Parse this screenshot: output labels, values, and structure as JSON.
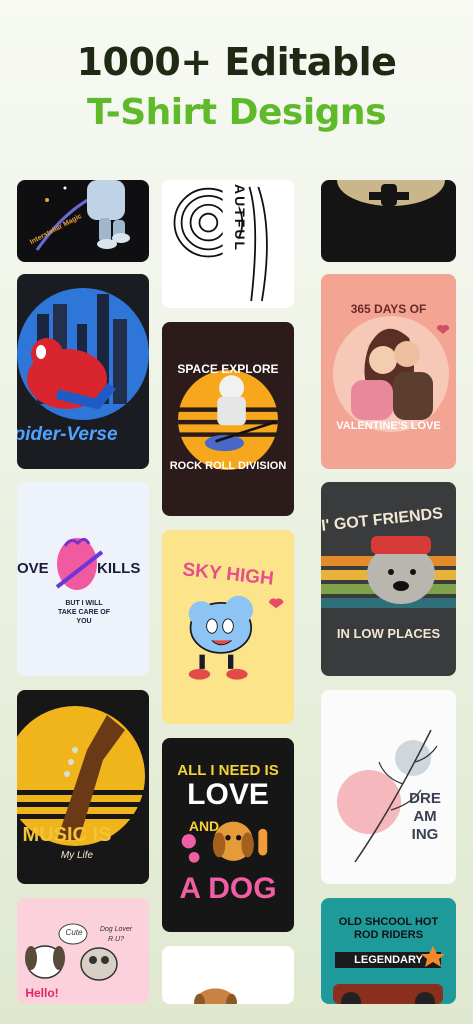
{
  "header": {
    "line1": "1000+ Editable",
    "line2": "T-Shirt Designs"
  },
  "colors": {
    "title_dark": "#1f2a14",
    "title_green": "#5fba2a"
  },
  "designs": {
    "interstellar": {
      "text": "Interstellar Magic"
    },
    "beautiful": {
      "text": "AUTFUL"
    },
    "spider": {
      "text": "Spider-Verse"
    },
    "valentine": {
      "top": "365 DAYS OF",
      "bottom": "VALENTINE'S LOVE"
    },
    "space": {
      "top": "SPACE EXPLORE",
      "bottom": "ROCK ROLL DIVISION"
    },
    "love_kills": {
      "left": "OVE",
      "right": "KILLS",
      "sub1": "BUT I WILL",
      "sub2": "TAKE CARE OF",
      "sub3": "YOU"
    },
    "sky_high": {
      "text": "SKY HIGH"
    },
    "friends": {
      "top": "I' GOT FRIENDS",
      "bottom": "IN LOW PLACES"
    },
    "music": {
      "main": "MUSIC IS",
      "script": "My Life"
    },
    "love_dog": {
      "l1": "ALL I NEED IS",
      "l2": "LOVE",
      "l3": "AND",
      "l4": "A DOG"
    },
    "dreaming": {
      "l1": "DRE",
      "l2": "AM",
      "l3": "ING"
    },
    "hello_dogs": {
      "hello": "Hello!",
      "cute": "Cute",
      "lover": "Dog Lover",
      "ru": "R.U?"
    },
    "hot_rod": {
      "top": "OLD SHCOOL HOT ROD RIDERS",
      "banner": "LEGENDARY"
    }
  }
}
